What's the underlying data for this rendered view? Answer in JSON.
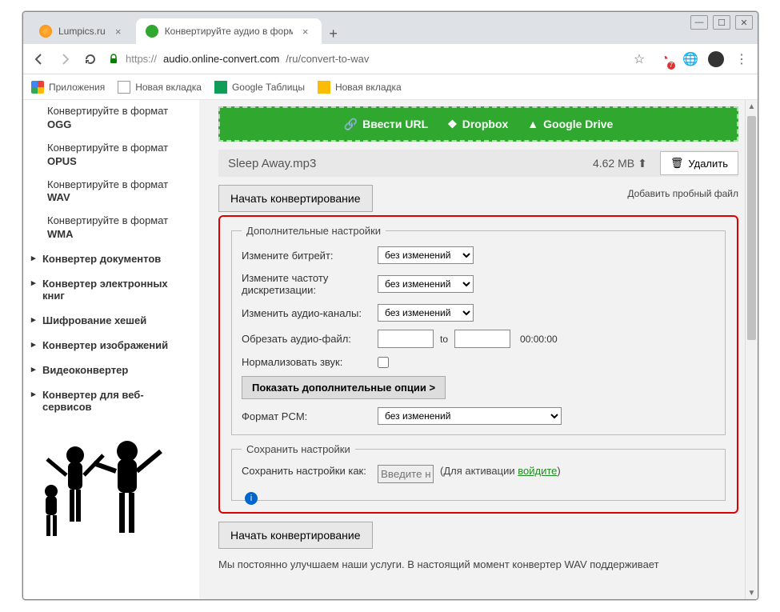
{
  "window": {
    "min": "—",
    "max": "☐",
    "close": "✕"
  },
  "tabs": [
    {
      "title": "Lumpics.ru",
      "favColor": "#f7a000"
    },
    {
      "title": "Конвертируйте аудио в формат",
      "favColor": "#30a830"
    }
  ],
  "addr": {
    "scheme": "https://",
    "host": "audio.online-convert.com",
    "path": "/ru/convert-to-wav"
  },
  "bookmarks": [
    {
      "label": "Приложения"
    },
    {
      "label": "Новая вкладка"
    },
    {
      "label": "Google Таблицы"
    },
    {
      "label": "Новая вкладка"
    }
  ],
  "sidebar": {
    "formats": [
      {
        "pre": "Конвертируйте в формат",
        "fmt": "OGG"
      },
      {
        "pre": "Конвертируйте в формат",
        "fmt": "OPUS"
      },
      {
        "pre": "Конвертируйте в формат",
        "fmt": "WAV"
      },
      {
        "pre": "Конвертируйте в формат",
        "fmt": "WMA"
      }
    ],
    "cats": [
      "Конвертер документов",
      "Конвертер электронных книг",
      "Шифрование хешей",
      "Конвертер изображений",
      "Видеоконвертер",
      "Конвертер для веб-сервисов"
    ]
  },
  "upload": {
    "url": "Ввести URL",
    "dropbox": "Dropbox",
    "gdrive": "Google Drive"
  },
  "file": {
    "name": "Sleep Away.mp3",
    "size": "4.62 MB",
    "del": "Удалить"
  },
  "convert": "Начать конвертирование",
  "addTrial": "Добавить пробный файл",
  "settings": {
    "legend": "Дополнительные настройки",
    "bitrate": {
      "lbl": "Измените битрейт:",
      "val": "без изменений"
    },
    "freq": {
      "lbl": "Измените частоту дискретизации:",
      "val": "без изменений"
    },
    "channels": {
      "lbl": "Изменить аудио-каналы:",
      "val": "без изменений"
    },
    "trim": {
      "lbl": "Обрезать аудио-файл:",
      "to": "to",
      "time": "00:00:00"
    },
    "normalize": {
      "lbl": "Нормализовать звук:"
    },
    "more": "Показать дополнительные опции >",
    "pcm": {
      "lbl": "Формат PCM:",
      "val": "без изменений"
    }
  },
  "save": {
    "legend": "Сохранить настройки",
    "lbl": "Сохранить настройки как:",
    "ph": "Введите название",
    "note1": "(Для активации ",
    "link": "войдите",
    "note2": ")"
  },
  "footer": "Мы постоянно улучшаем наши услуги. В настоящий момент конвертер WAV поддерживает"
}
